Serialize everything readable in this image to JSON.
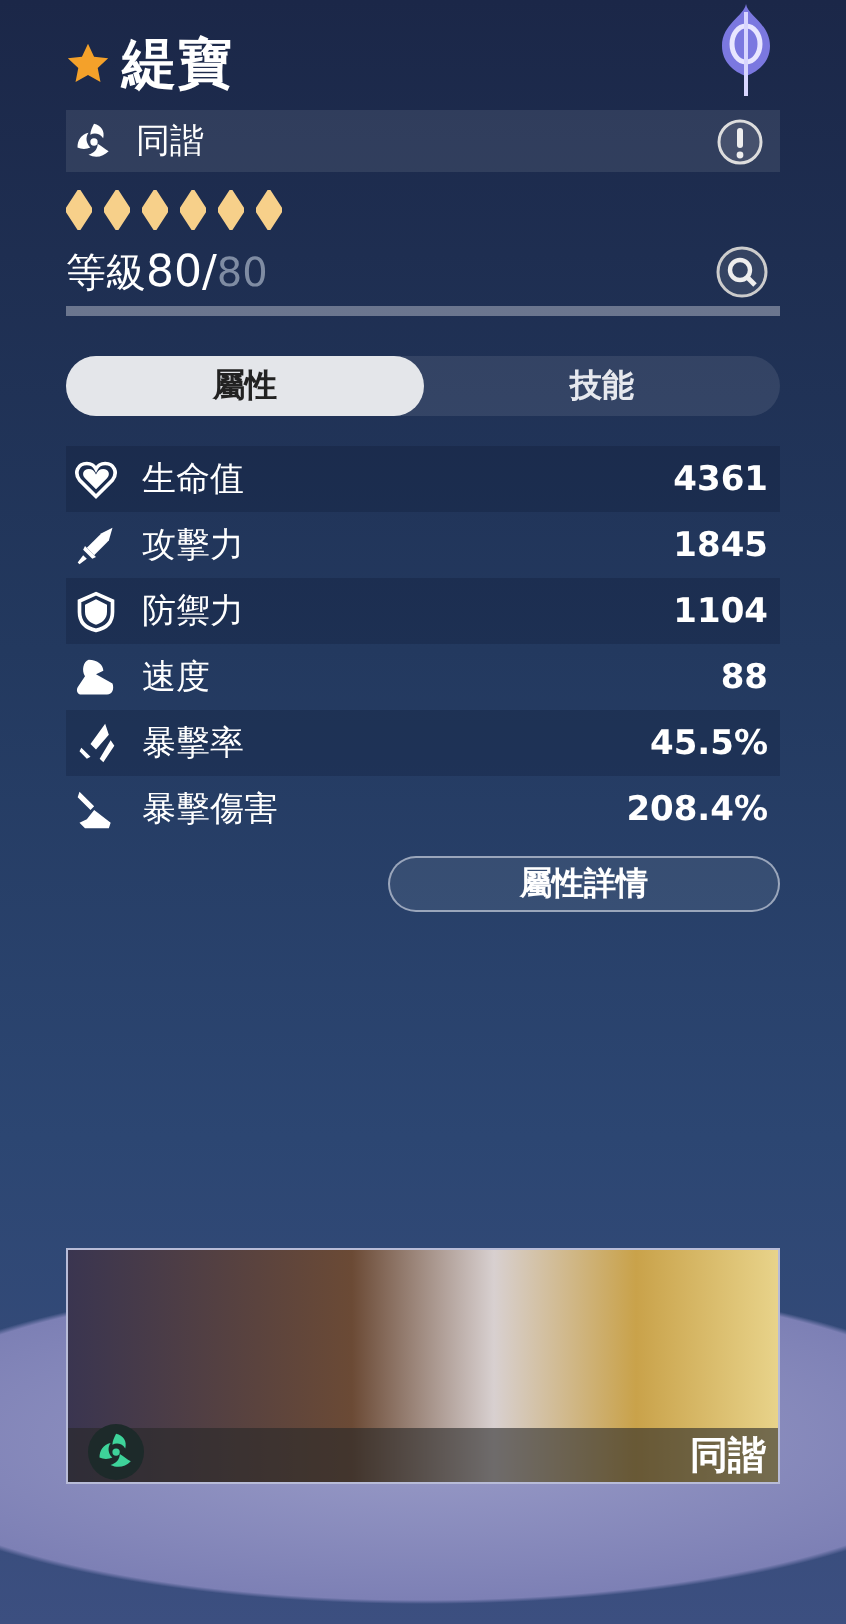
{
  "character": {
    "name": "緹寶",
    "path": "同諧"
  },
  "eidolons": [
    {
      "filled": true
    },
    {
      "filled": true
    },
    {
      "filled": true
    },
    {
      "filled": true
    },
    {
      "filled": true
    },
    {
      "filled": true
    }
  ],
  "level": {
    "label": "等級",
    "current": "80",
    "separator": "/",
    "max": "80"
  },
  "tabs": [
    {
      "label": "屬性",
      "selected": true
    },
    {
      "label": "技能",
      "selected": false
    }
  ],
  "stats": [
    {
      "kind": "hp",
      "label": "生命值",
      "value": "4361"
    },
    {
      "kind": "atk",
      "label": "攻擊力",
      "value": "1845"
    },
    {
      "kind": "def",
      "label": "防禦力",
      "value": "1104"
    },
    {
      "kind": "spd",
      "label": "速度",
      "value": "88"
    },
    {
      "kind": "critrate",
      "label": "暴擊率",
      "value": "45.5%"
    },
    {
      "kind": "critdmg",
      "label": "暴擊傷害",
      "value": "208.4%"
    }
  ],
  "details_button": "屬性詳情",
  "light_cone": {
    "path": "同諧"
  }
}
